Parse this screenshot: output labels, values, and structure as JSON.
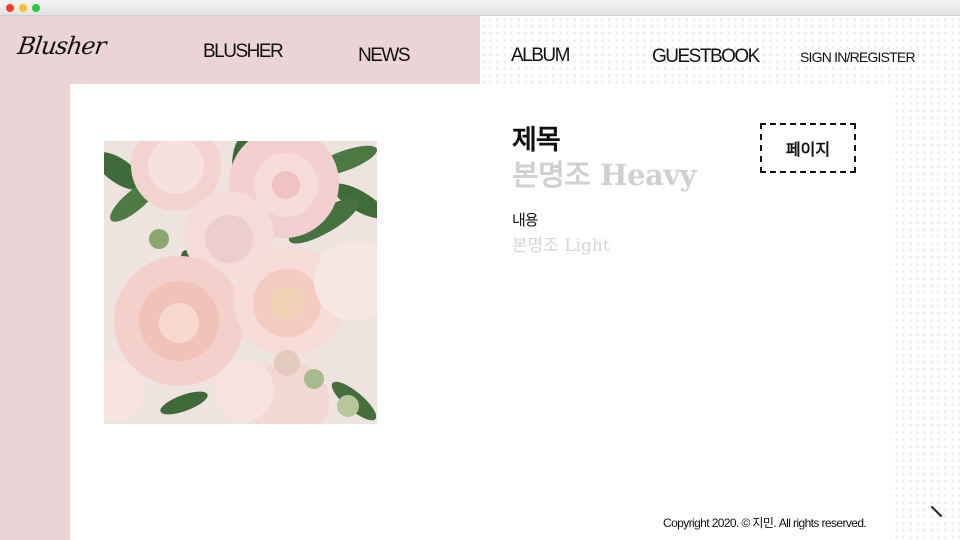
{
  "window": {
    "controls": [
      "close",
      "minimize",
      "maximize"
    ]
  },
  "brand": {
    "logo_text": "Blusher"
  },
  "nav": {
    "blusher": "BLUSHER",
    "news": "NEWS",
    "album": "ALBUM",
    "guestbook": "GUESTBOOK",
    "sign": "SIGN IN/REGISTER"
  },
  "main": {
    "title": "제목",
    "subtitle": "본명조 Heavy",
    "content": "내용",
    "content_sub": "본명조 Light",
    "page_button": "페이지"
  },
  "footer": {
    "copyright": "Copyright 2020. © 지민. All rights reserved."
  },
  "colors": {
    "pink": "#ebd4d6",
    "muted_text": "#d0d0d0",
    "accent": "#111111"
  },
  "icons": {
    "corner": "diagonal-arrow-icon"
  }
}
